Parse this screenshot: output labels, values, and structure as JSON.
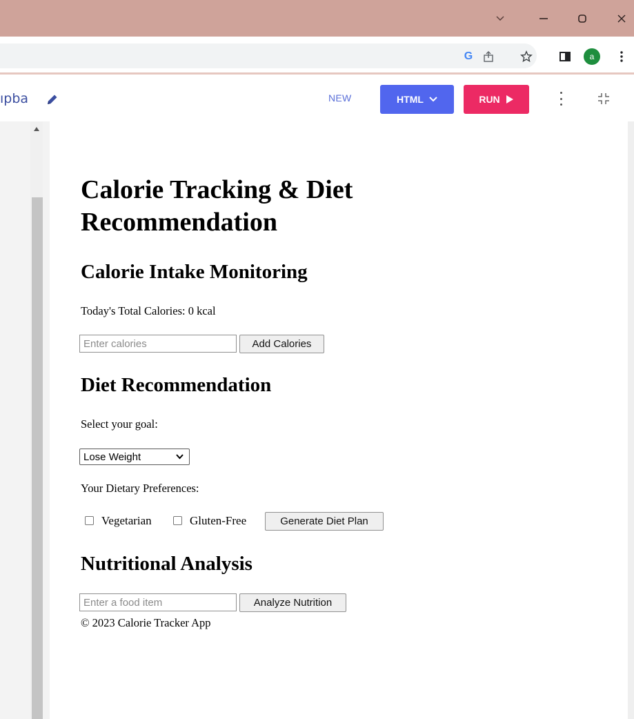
{
  "browser": {
    "window_controls": {
      "dropdown": "⌄",
      "minimize": "—",
      "restore": "▢",
      "close": "✕"
    },
    "toolbar_icons": [
      "google-icon",
      "share-icon",
      "star-icon",
      "sidepanel-icon",
      "profile-avatar",
      "menu-icon"
    ],
    "profile_initial": "a",
    "google_glyph": "G"
  },
  "editor": {
    "project_name": "ıpba",
    "new_label": "NEW",
    "html_button": "HTML",
    "run_button": "RUN"
  },
  "preview": {
    "title": "Calorie Tracking & Diet Recommendation",
    "calorie_section": {
      "heading": "Calorie Intake Monitoring",
      "total_text": "Today's Total Calories: 0 kcal",
      "input_placeholder": "Enter calories",
      "button": "Add Calories"
    },
    "diet_section": {
      "heading": "Diet Recommendation",
      "goal_label": "Select your goal:",
      "goal_selected": "Lose Weight",
      "preferences_label": "Your Dietary Preferences:",
      "option_vegetarian": "Vegetarian",
      "option_gluten_free": "Gluten-Free",
      "button": "Generate Diet Plan"
    },
    "nutrition_section": {
      "heading": "Nutritional Analysis",
      "input_placeholder": "Enter a food item",
      "button": "Analyze Nutrition"
    },
    "footer": "© 2023 Calorie Tracker App"
  },
  "colors": {
    "titlebar": "#cfa39a",
    "html_button": "#5166ee",
    "run_button": "#ec2a64",
    "accent_text": "#3b4ea0",
    "profile_avatar": "#1e8e3e"
  }
}
